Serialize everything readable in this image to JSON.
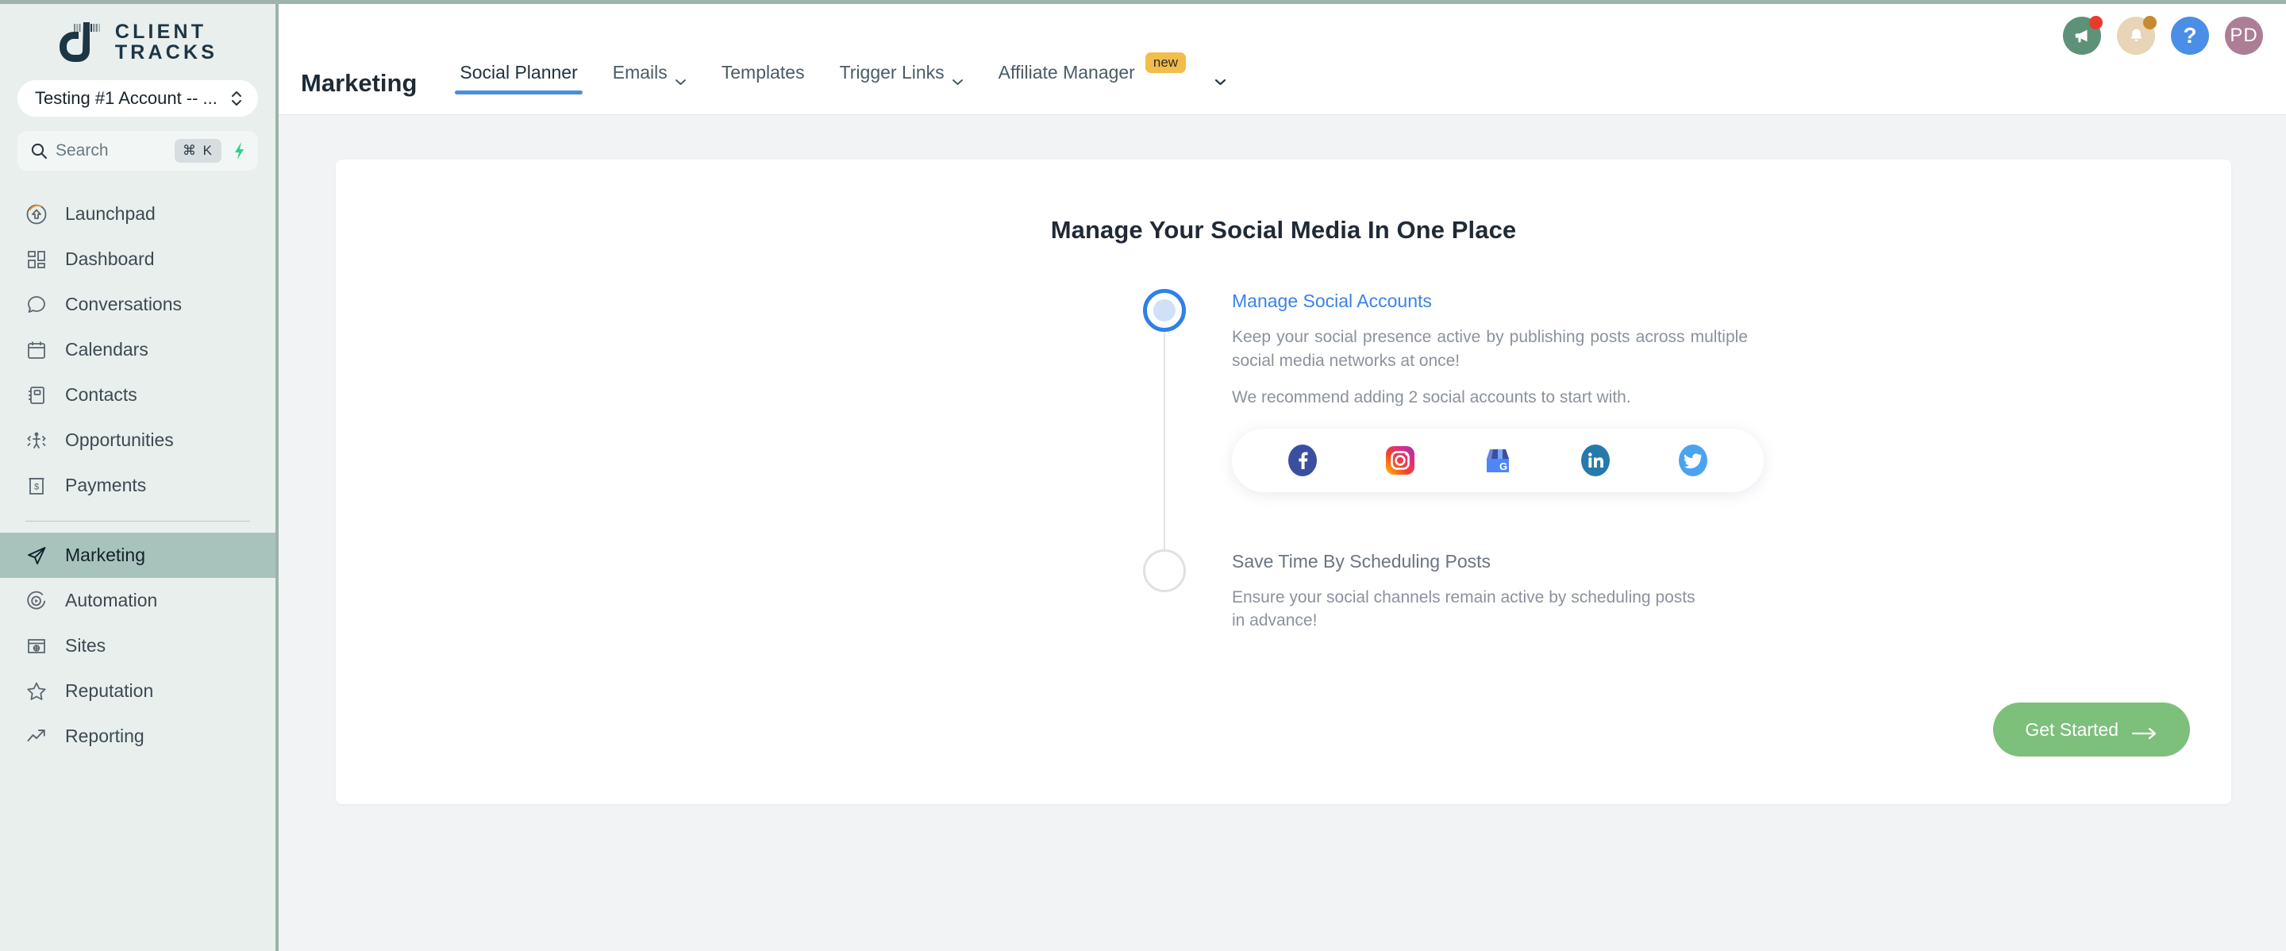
{
  "brand": {
    "name_line1": "CLIENT",
    "name_line2": "TRACKS",
    "logo_icon": "client-tracks-logo"
  },
  "sidebar": {
    "account_selector": {
      "value": "Testing #1 Account -- ...",
      "icon": "chevron-up-down-icon"
    },
    "search": {
      "placeholder": "Search",
      "shortcut": "⌘ K",
      "icon": "search-icon",
      "bolt_icon": "lightning-bolt-icon"
    },
    "items": [
      {
        "label": "Launchpad",
        "icon": "rocket-launch-icon",
        "active": false
      },
      {
        "label": "Dashboard",
        "icon": "dashboard-grid-icon",
        "active": false
      },
      {
        "label": "Conversations",
        "icon": "chat-bubble-icon",
        "active": false
      },
      {
        "label": "Calendars",
        "icon": "calendar-icon",
        "active": false
      },
      {
        "label": "Contacts",
        "icon": "contacts-book-icon",
        "active": false
      },
      {
        "label": "Opportunities",
        "icon": "opportunities-icon",
        "active": false
      },
      {
        "label": "Payments",
        "icon": "payments-icon",
        "active": false
      }
    ],
    "items_lower": [
      {
        "label": "Marketing",
        "icon": "paper-plane-icon",
        "active": true
      },
      {
        "label": "Automation",
        "icon": "play-circle-icon",
        "active": false
      },
      {
        "label": "Sites",
        "icon": "browser-globe-icon",
        "active": false
      },
      {
        "label": "Reputation",
        "icon": "star-icon",
        "active": false
      },
      {
        "label": "Reporting",
        "icon": "trend-up-icon",
        "active": false
      }
    ]
  },
  "header": {
    "title": "Marketing",
    "tabs": [
      {
        "label": "Social Planner",
        "active": true,
        "caret": false,
        "badge": null
      },
      {
        "label": "Emails",
        "active": false,
        "caret": true,
        "badge": null
      },
      {
        "label": "Templates",
        "active": false,
        "caret": false,
        "badge": null
      },
      {
        "label": "Trigger Links",
        "active": false,
        "caret": true,
        "badge": null
      },
      {
        "label": "Affiliate Manager",
        "active": false,
        "caret": false,
        "badge": "new"
      }
    ],
    "overflow_caret_icon": "chevron-down-icon",
    "actions": [
      {
        "name": "megaphone-icon",
        "label": "",
        "dot": "red"
      },
      {
        "name": "notifications-bell-icon",
        "label": "",
        "dot": "amber"
      },
      {
        "name": "help-icon",
        "label": "?",
        "dot": null
      },
      {
        "name": "user-avatar",
        "label": "PD",
        "dot": null
      }
    ]
  },
  "main": {
    "card_title": "Manage Your Social Media In One Place",
    "steps": [
      {
        "title": "Manage Social Accounts",
        "state": "active",
        "desc": "Keep your social presence active by publishing posts across multiple social media networks at once!",
        "note": "We recommend adding 2 social accounts to start with."
      },
      {
        "title": "Save Time By Scheduling Posts",
        "state": "inactive",
        "desc": "Ensure your social channels remain active by scheduling posts in advance!",
        "note": ""
      }
    ],
    "social_networks": [
      {
        "name": "facebook-icon",
        "label": "Facebook"
      },
      {
        "name": "instagram-icon",
        "label": "Instagram"
      },
      {
        "name": "google-business-icon",
        "label": "Google Business Profile"
      },
      {
        "name": "linkedin-icon",
        "label": "LinkedIn"
      },
      {
        "name": "twitter-icon",
        "label": "Twitter"
      }
    ],
    "get_started_label": "Get Started",
    "get_started_icon": "arrow-right-icon"
  },
  "colors": {
    "sidebar_bg": "#e9efed",
    "sidebar_border": "#9db3ab",
    "active_nav": "#a8c3bc",
    "accent_blue": "#3b82e8",
    "tab_underline": "#4a90d9",
    "badge_new": "#f2bd4b",
    "get_started": "#7cc07c",
    "content_bg": "#f2f3f5",
    "brand_dark": "#1d3644"
  }
}
